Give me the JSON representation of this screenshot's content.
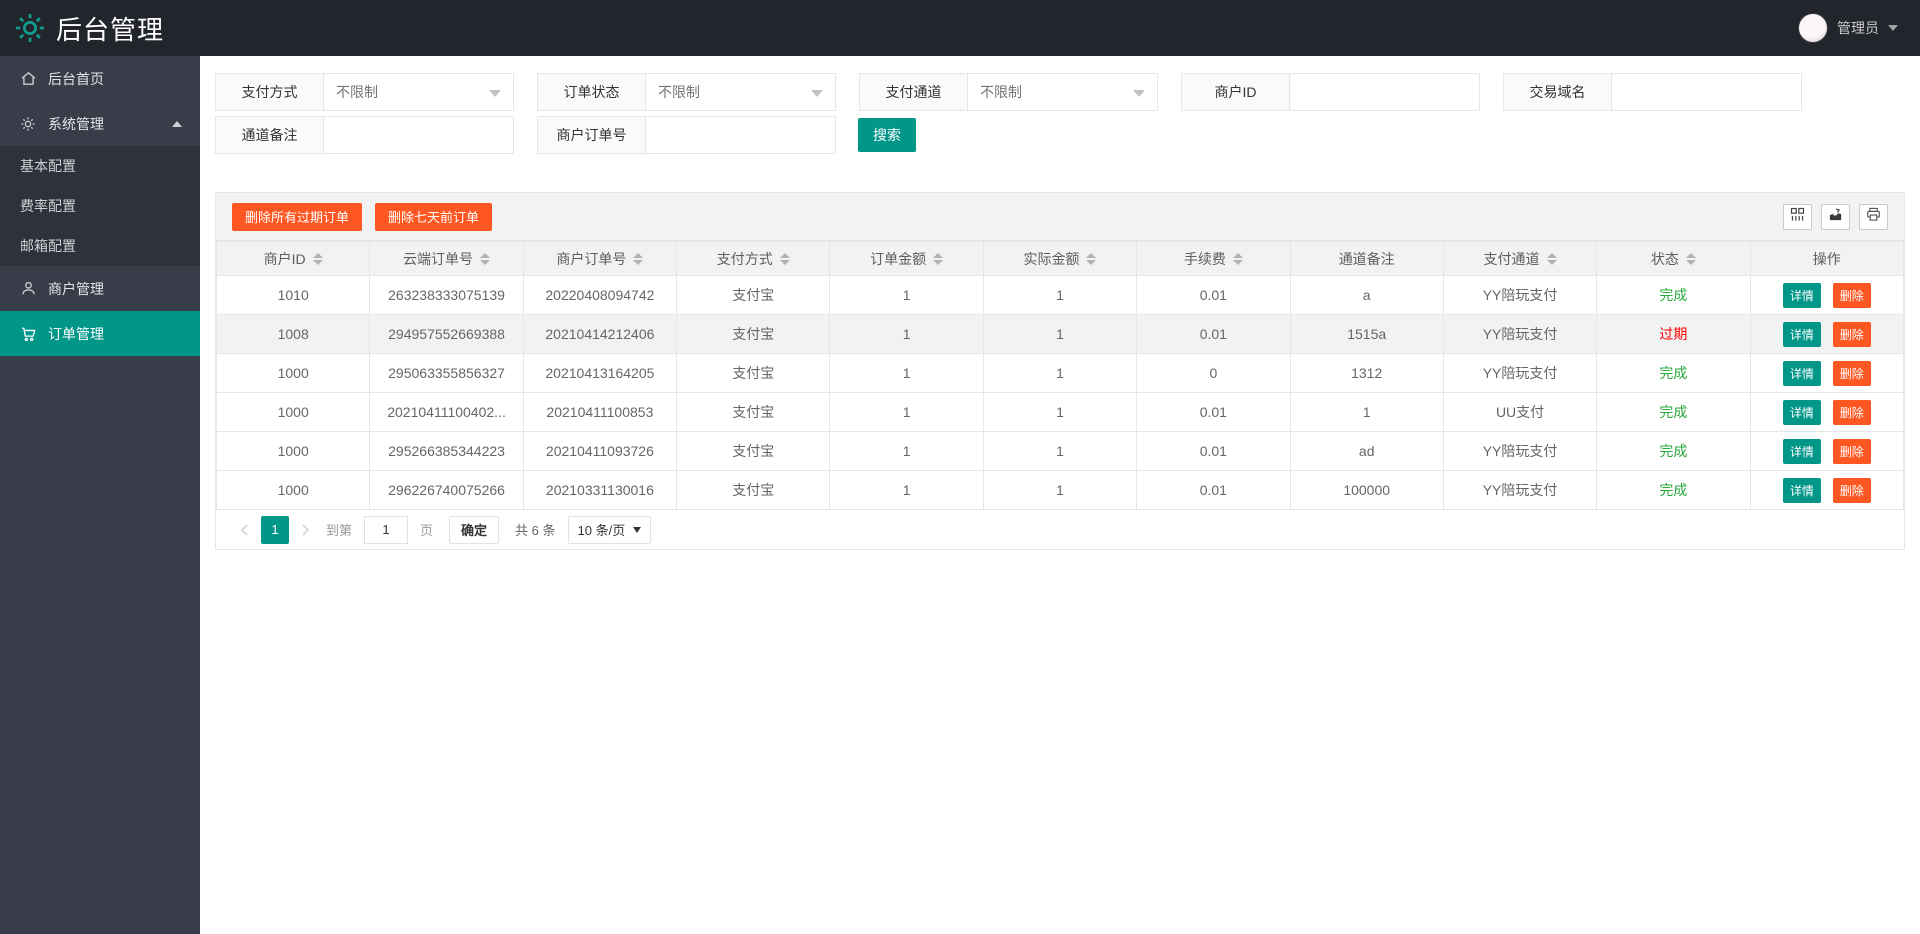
{
  "header": {
    "app_title": "后台管理",
    "username": "管理员"
  },
  "sidebar": {
    "items": [
      {
        "label": "后台首页",
        "icon": "home"
      },
      {
        "label": "系统管理",
        "icon": "gear",
        "expanded": true
      },
      {
        "label": "基本配置",
        "submenu": true
      },
      {
        "label": "费率配置",
        "submenu": true
      },
      {
        "label": "邮箱配置",
        "submenu": true
      },
      {
        "label": "商户管理",
        "icon": "user"
      },
      {
        "label": "订单管理",
        "icon": "cart",
        "active": true
      }
    ]
  },
  "filters": {
    "row1": [
      {
        "label": "支付方式",
        "type": "select",
        "value": "不限制"
      },
      {
        "label": "订单状态",
        "type": "select",
        "value": "不限制"
      },
      {
        "label": "支付通道",
        "type": "select",
        "value": "不限制"
      },
      {
        "label": "商户ID",
        "type": "input",
        "value": ""
      },
      {
        "label": "交易域名",
        "type": "input",
        "value": ""
      }
    ],
    "row2": [
      {
        "label": "通道备注",
        "type": "input",
        "value": ""
      },
      {
        "label": "商户订单号",
        "type": "input",
        "value": ""
      }
    ],
    "search_button": "搜索"
  },
  "table_toolbar": {
    "delete_expired_button": "删除所有过期订单",
    "delete_week_button": "删除七天前订单",
    "icon_buttons": [
      "cols-icon",
      "export-icon",
      "print-icon"
    ]
  },
  "table": {
    "columns": [
      {
        "label": "商户ID",
        "sortable": true
      },
      {
        "label": "云端订单号",
        "sortable": true
      },
      {
        "label": "商户订单号",
        "sortable": true
      },
      {
        "label": "支付方式",
        "sortable": true
      },
      {
        "label": "订单金额",
        "sortable": true
      },
      {
        "label": "实际金额",
        "sortable": true
      },
      {
        "label": "手续费",
        "sortable": true
      },
      {
        "label": "通道备注",
        "sortable": false
      },
      {
        "label": "支付通道",
        "sortable": true
      },
      {
        "label": "状态",
        "sortable": true
      },
      {
        "label": "操作",
        "sortable": false
      }
    ],
    "rows": [
      {
        "merchant_id": "1010",
        "cloud_order_no": "263238333075139",
        "merchant_order_no": "20220408094742",
        "pay_method": "支付宝",
        "order_amount": "1",
        "actual_amount": "1",
        "fee": "0.01",
        "channel_remark": "a",
        "pay_channel": "YY陪玩支付",
        "status": "完成",
        "highlighted": false
      },
      {
        "merchant_id": "1008",
        "cloud_order_no": "294957552669388",
        "merchant_order_no": "20210414212406",
        "pay_method": "支付宝",
        "order_amount": "1",
        "actual_amount": "1",
        "fee": "0.01",
        "channel_remark": "1515a",
        "pay_channel": "YY陪玩支付",
        "status": "过期",
        "highlighted": true
      },
      {
        "merchant_id": "1000",
        "cloud_order_no": "295063355856327",
        "merchant_order_no": "20210413164205",
        "pay_method": "支付宝",
        "order_amount": "1",
        "actual_amount": "1",
        "fee": "0",
        "channel_remark": "1312",
        "pay_channel": "YY陪玩支付",
        "status": "完成",
        "highlighted": false
      },
      {
        "merchant_id": "1000",
        "cloud_order_no": "20210411100402...",
        "merchant_order_no": "20210411100853",
        "pay_method": "支付宝",
        "order_amount": "1",
        "actual_amount": "1",
        "fee": "0.01",
        "channel_remark": "1",
        "pay_channel": "UU支付",
        "status": "完成",
        "highlighted": false
      },
      {
        "merchant_id": "1000",
        "cloud_order_no": "295266385344223",
        "merchant_order_no": "20210411093726",
        "pay_method": "支付宝",
        "order_amount": "1",
        "actual_amount": "1",
        "fee": "0.01",
        "channel_remark": "ad",
        "pay_channel": "YY陪玩支付",
        "status": "完成",
        "highlighted": false
      },
      {
        "merchant_id": "1000",
        "cloud_order_no": "296226740075266",
        "merchant_order_no": "20210331130016",
        "pay_method": "支付宝",
        "order_amount": "1",
        "actual_amount": "1",
        "fee": "0.01",
        "channel_remark": "100000",
        "pay_channel": "YY陪玩支付",
        "status": "完成",
        "highlighted": false
      }
    ],
    "actions": {
      "detail": "详情",
      "delete": "删除"
    },
    "status_colors": {
      "完成": "#28a93c",
      "过期": "#ff0000"
    }
  },
  "pagination": {
    "current_page": "1",
    "goto_prefix": "到第",
    "goto_page_value": "1",
    "goto_suffix": "页",
    "confirm_button": "确定",
    "total_text": "共 6 条",
    "page_size": "10 条/页"
  },
  "colors": {
    "accent_teal": "#009688",
    "accent_orange": "#ff5722",
    "header_bg": "#22252c",
    "sidebar_bg": "#393d49",
    "submenu_bg": "#2f323b",
    "status_done": "#28a93c",
    "status_expired": "#ff0000"
  }
}
